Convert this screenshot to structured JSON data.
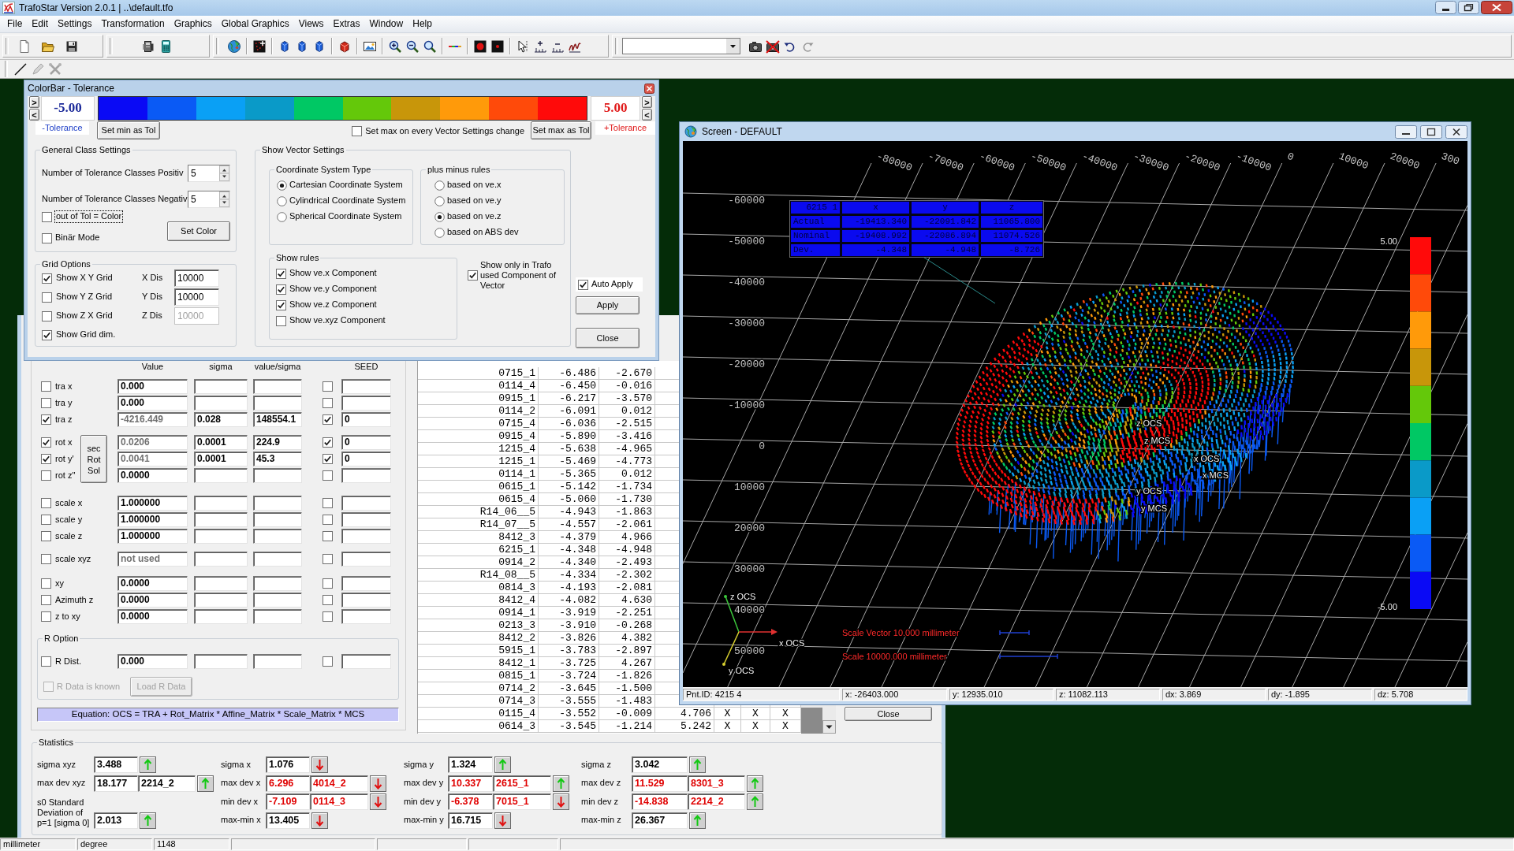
{
  "app": {
    "title": "TrafoStar Version 2.0.1 | ..\\default.tfo"
  },
  "menu": [
    "File",
    "Edit",
    "Settings",
    "Transformation",
    "Graphics",
    "Global Graphics",
    "Views",
    "Extras",
    "Window",
    "Help"
  ],
  "toolbar": [
    {
      "groups": [
        [
          {
            "kind": "new",
            "disabled": false
          },
          {
            "kind": "open",
            "disabled": false
          },
          {
            "kind": "save",
            "disabled": false
          }
        ]
      ]
    },
    {
      "groups": [
        [
          {
            "kind": "device",
            "disabled": false
          },
          {
            "kind": "calculator",
            "disabled": false
          }
        ]
      ]
    },
    {
      "groups": [
        [
          {
            "kind": "globe",
            "disabled": false
          }
        ],
        [
          {
            "kind": "points",
            "disabled": false
          }
        ],
        [
          {
            "kind": "cube",
            "disabled": false
          },
          {
            "kind": "cube",
            "disabled": false
          },
          {
            "kind": "cube",
            "disabled": false
          }
        ],
        [
          {
            "kind": "block",
            "disabled": false
          }
        ],
        [
          {
            "kind": "picture",
            "disabled": false
          }
        ],
        [
          {
            "kind": "zoomin",
            "disabled": false
          },
          {
            "kind": "zoomout",
            "disabled": false
          },
          {
            "kind": "zoom",
            "disabled": false
          }
        ],
        [
          {
            "kind": "gradient",
            "disabled": false
          }
        ],
        [
          {
            "kind": "dot",
            "disabled": false
          },
          {
            "kind": "smalldot",
            "disabled": false
          }
        ],
        [
          {
            "kind": "cursor",
            "disabled": false
          },
          {
            "kind": "axisplus",
            "disabled": false
          },
          {
            "kind": "axisminus",
            "disabled": false
          },
          {
            "kind": "scribble",
            "disabled": false
          }
        ]
      ]
    },
    {
      "groups": [
        [
          {
            "kind": "dropdown",
            "disabled": false
          },
          {
            "kind": "camera",
            "disabled": false
          },
          {
            "kind": "nocamera",
            "disabled": false
          },
          {
            "kind": "undo",
            "disabled": false
          },
          {
            "kind": "redo",
            "disabled": true
          }
        ]
      ]
    }
  ],
  "toolbar_2": [
    {
      "kind": "line",
      "disabled": false
    },
    {
      "kind": "pencil",
      "disabled": true
    },
    {
      "kind": "tools",
      "disabled": true
    }
  ],
  "colorbar_dialog": {
    "title": "ColorBar - Tolerance",
    "left_steppers": [
      ">",
      "<"
    ],
    "min_value": "-5.00",
    "classes": [
      {
        "color": "#0a0af5"
      },
      {
        "color": "#0a5af5"
      },
      {
        "color": "#0aa0f5"
      },
      {
        "color": "#0a9ac8"
      },
      {
        "color": "#00c864"
      },
      {
        "color": "#64c80a"
      },
      {
        "color": "#c8960a"
      },
      {
        "color": "#ff9a0a"
      },
      {
        "color": "#ff4a0a"
      },
      {
        "color": "#ff0a0a"
      }
    ],
    "max_value": "5.00",
    "right_steppers": [
      ">",
      "<"
    ],
    "min_label": "-Tolerance",
    "set_min_button": "Set min as Tol",
    "set_max_on_change": {
      "label": "Set max on every Vector Settings change",
      "checked": false
    },
    "set_max_button": "Set max as Tol",
    "max_label": "+Tolerance",
    "general": {
      "title": "General Class Settings",
      "positive": {
        "label": "Number of Tolerance Classes Positiv",
        "value": "5"
      },
      "negative": {
        "label": "Number of Tolerance Classes Negativ",
        "value": "5"
      },
      "out_of_tol": {
        "label": "out of Tol = Color",
        "checked": false,
        "focused": true
      },
      "binar_mode": {
        "label": "Binär Mode",
        "checked": false
      },
      "set_color_button": "Set Color"
    },
    "grid_options": {
      "title": "Grid Options",
      "items": [
        {
          "label": "Show X Y Grid",
          "checked": true,
          "distance": {
            "label": "X Dis",
            "value": "10000",
            "disabled": false
          }
        },
        {
          "label": "Show Y Z Grid",
          "checked": false,
          "distance": {
            "label": "Y Dis",
            "value": "10000",
            "disabled": false
          }
        },
        {
          "label": "Show Z X Grid",
          "checked": false,
          "distance": {
            "label": "Z Dis",
            "value": "10000",
            "disabled": true
          }
        },
        {
          "label": "Show Grid dim.",
          "checked": true
        }
      ]
    },
    "vector_settings": {
      "title": "Show Vector Settings",
      "coordinate_system": {
        "title": "Coordinate System Type",
        "options": [
          {
            "label": "Cartesian Coordinate System",
            "selected": true
          },
          {
            "label": "Cylindrical Coordinate System",
            "selected": false
          },
          {
            "label": "Spherical Coordinate System",
            "selected": false
          }
        ]
      },
      "plus_minus_rules": {
        "title": "plus minus rules",
        "options": [
          {
            "label": "based on ve.x",
            "selected": false
          },
          {
            "label": "based on ve.y",
            "selected": false
          },
          {
            "label": "based on ve.z",
            "selected": true
          },
          {
            "label": "based on ABS dev",
            "selected": false
          }
        ]
      },
      "show_rules": {
        "title": "Show rules",
        "items": [
          {
            "label": "Show ve.x Component",
            "checked": true
          },
          {
            "label": "Show ve.y Component",
            "checked": true
          },
          {
            "label": "Show ve.z Component",
            "checked": true
          },
          {
            "label": "Show ve.xyz Component",
            "checked": false
          }
        ]
      },
      "show_only_used": {
        "label": "Show only in Trafo used Component of Vector",
        "checked": true
      }
    },
    "auto_apply": {
      "label": "Auto Apply",
      "checked": true
    },
    "apply_button": "Apply",
    "close_button": "Close"
  },
  "transformation": {
    "column_headers": [
      "Value",
      "sigma",
      "value/sigma",
      "SEED"
    ],
    "groups": [
      {
        "rows": [
          {
            "label": "tra x",
            "checked": false,
            "value": "0.000",
            "value_disabled": false,
            "seed_checked": false
          },
          {
            "label": "tra y",
            "checked": false,
            "value": "0.000",
            "value_disabled": false,
            "seed_checked": false
          },
          {
            "label": "tra z",
            "checked": true,
            "value": "-4216.449",
            "value_disabled": true,
            "sigma": "0.028",
            "value_sigma": "148554.1",
            "seed_checked": true,
            "seed": "0"
          }
        ]
      },
      {
        "button": "sec Rot Sol",
        "rows": [
          {
            "label": "rot x",
            "checked": true,
            "value": "0.0206",
            "value_disabled": true,
            "sigma": "0.0001",
            "value_sigma": "224.9",
            "seed_checked": true,
            "seed": "0"
          },
          {
            "label": "rot y'",
            "checked": true,
            "value": "0.0041",
            "value_disabled": true,
            "sigma": "0.0001",
            "value_sigma": "45.3",
            "seed_checked": true,
            "seed": "0"
          },
          {
            "label": "rot z''",
            "checked": false,
            "value": "0.0000",
            "value_disabled": false,
            "seed_checked": false
          }
        ]
      },
      {
        "rows": [
          {
            "label": "scale x",
            "checked": false,
            "value": "1.000000",
            "value_disabled": false,
            "seed_checked": false
          },
          {
            "label": "scale y",
            "checked": false,
            "value": "1.000000",
            "value_disabled": false,
            "seed_checked": false
          },
          {
            "label": "scale z",
            "checked": false,
            "value": "1.000000",
            "value_disabled": false,
            "seed_checked": false
          }
        ]
      },
      {
        "rows": [
          {
            "label": "scale xyz",
            "checked": false,
            "value": "not used",
            "value_disabled": true,
            "seed_checked": false
          }
        ]
      },
      {
        "rows": [
          {
            "label": "xy",
            "checked": false,
            "value": "0.0000",
            "value_disabled": false,
            "seed_checked": false
          },
          {
            "label": "Azimuth z",
            "checked": false,
            "value": "0.0000",
            "value_disabled": false,
            "seed_checked": false
          },
          {
            "label": "z to xy",
            "checked": false,
            "value": "0.0000",
            "value_disabled": false,
            "seed_checked": false
          }
        ]
      }
    ],
    "r_option": {
      "title": "R Option",
      "r_dist": {
        "label": "R Dist.",
        "checked": false,
        "value": "0.000",
        "value_disabled": false,
        "seed_checked": false
      },
      "r_data_known": {
        "label": "R Data is known",
        "checked": false,
        "disabled": true
      },
      "load_button": {
        "label": "Load R Data",
        "disabled": true
      }
    },
    "equation": "Equation: OCS = TRA + Rot_Matrix * Affine_Matrix * Scale_Matrix * MCS"
  },
  "deviation_table": {
    "rows": [
      {
        "cells": [
          "0715_1",
          "-6.486",
          "-2.670"
        ]
      },
      {
        "cells": [
          "0114_4",
          "-6.450",
          "-0.016"
        ]
      },
      {
        "cells": [
          "0915_1",
          "-6.217",
          "-3.570"
        ]
      },
      {
        "cells": [
          "0114_2",
          "-6.091",
          "0.012"
        ]
      },
      {
        "cells": [
          "0715_4",
          "-6.036",
          "-2.515"
        ]
      },
      {
        "cells": [
          "0915_4",
          "-5.890",
          "-3.416"
        ]
      },
      {
        "cells": [
          "1215_4",
          "-5.638",
          "-4.965"
        ]
      },
      {
        "cells": [
          "1215_1",
          "-5.469",
          "-4.773"
        ]
      },
      {
        "cells": [
          "0114_1",
          "-5.365",
          "0.012"
        ]
      },
      {
        "cells": [
          "0615_1",
          "-5.142",
          "-1.734"
        ]
      },
      {
        "cells": [
          "0615_4",
          "-5.060",
          "-1.730"
        ]
      },
      {
        "cells": [
          "R14_06__5",
          "-4.943",
          "-1.863"
        ]
      },
      {
        "cells": [
          "R14_07__5",
          "-4.557",
          "-2.061"
        ]
      },
      {
        "cells": [
          "8412_3",
          "-4.379",
          "4.966"
        ]
      },
      {
        "cells": [
          "6215_1",
          "-4.348",
          "-4.948"
        ]
      },
      {
        "cells": [
          "0914_2",
          "-4.340",
          "-2.493"
        ]
      },
      {
        "cells": [
          "R14_08__5",
          "-4.334",
          "-2.302"
        ]
      },
      {
        "cells": [
          "0814_3",
          "-4.193",
          "-2.081"
        ]
      },
      {
        "cells": [
          "8412_4",
          "-4.082",
          "4.630"
        ]
      },
      {
        "cells": [
          "0914_1",
          "-3.919",
          "-2.251"
        ]
      },
      {
        "cells": [
          "0213_3",
          "-3.910",
          "-0.268"
        ]
      },
      {
        "cells": [
          "8412_2",
          "-3.826",
          "4.382"
        ]
      },
      {
        "cells": [
          "5915_1",
          "-3.783",
          "-2.897"
        ]
      },
      {
        "cells": [
          "8412_1",
          "-3.725",
          "4.267"
        ]
      },
      {
        "cells": [
          "0815_1",
          "-3.724",
          "-1.826"
        ]
      },
      {
        "cells": [
          "0714_2",
          "-3.645",
          "-1.500"
        ]
      },
      {
        "cells": [
          "0714_3",
          "-3.555",
          "-1.483"
        ]
      },
      {
        "cells": [
          "0115_4",
          "-3.552",
          "-0.009",
          "4.706",
          "X",
          "X",
          "X"
        ]
      },
      {
        "cells": [
          "0614_3",
          "-3.545",
          "-1.214",
          "5.242",
          "X",
          "X",
          "X"
        ]
      }
    ]
  },
  "form_close_button": "Close",
  "statistics": {
    "title": "Statistics",
    "columns": [
      {
        "sigma": {
          "label": "sigma xyz",
          "value": "3.488",
          "rising": true,
          "alert": false
        },
        "max_dev": {
          "label": "max dev xyz",
          "value": "18.177",
          "point": "2214_2",
          "rising": true,
          "alert": false
        },
        "s0": {
          "label": "s0 Standard Deviation of p=1 [sigma 0]",
          "value": "2.013",
          "rising": true,
          "alert": false
        }
      },
      {
        "sigma": {
          "label": "sigma x",
          "value": "1.076",
          "rising": false,
          "alert": false
        },
        "max_dev": {
          "label": "max dev x",
          "value": "6.296",
          "point": "4014_2",
          "rising": false,
          "alert": true
        },
        "min_dev": {
          "label": "min dev x",
          "value": "-7.109",
          "point": "0114_3",
          "rising": false,
          "alert": true
        },
        "max_min": {
          "label": "max-min x",
          "value": "13.405",
          "rising": false,
          "alert": false
        }
      },
      {
        "sigma": {
          "label": "sigma y",
          "value": "1.324",
          "rising": true,
          "alert": false
        },
        "max_dev": {
          "label": "max dev y",
          "value": "10.337",
          "point": "2615_1",
          "rising": true,
          "alert": true
        },
        "min_dev": {
          "label": "min dev y",
          "value": "-6.378",
          "point": "7015_1",
          "rising": false,
          "alert": true
        },
        "max_min": {
          "label": "max-min y",
          "value": "16.715",
          "rising": false,
          "alert": false
        }
      },
      {
        "sigma": {
          "label": "sigma z",
          "value": "3.042",
          "rising": true,
          "alert": false
        },
        "max_dev": {
          "label": "max dev z",
          "value": "11.529",
          "point": "8301_3",
          "rising": true,
          "alert": true
        },
        "min_dev": {
          "label": "min dev z",
          "value": "-14.838",
          "point": "2214_2",
          "rising": true,
          "alert": true
        },
        "max_min": {
          "label": "max-min z",
          "value": "26.367",
          "rising": true,
          "alert": false
        }
      }
    ]
  },
  "screen_window": {
    "title": "Screen - DEFAULT",
    "top_axis_labels": [
      "-80000",
      "-70000",
      "-60000",
      "-50000",
      "-40000",
      "-30000",
      "-20000",
      "-10000",
      "0",
      "10000",
      "20000",
      "300"
    ],
    "left_axis_labels": [
      "-60000",
      "-50000",
      "-40000",
      "-30000",
      "-20000",
      "-10000",
      "0",
      "10000",
      "20000",
      "30000",
      "40000",
      "50000"
    ],
    "info_table": {
      "columns": [
        "6215 1",
        "x",
        "y",
        "z"
      ],
      "rows": [
        [
          "Actual",
          "-19413.340",
          "-22091.842",
          "11065.800"
        ],
        [
          "Nominal",
          "-19408.992",
          "-22086.894",
          "11074.526"
        ],
        [
          "Dev.",
          "-4.348",
          "-4.948",
          "-8.726"
        ]
      ]
    },
    "cloud_labels": [
      "z OCS",
      "z MCS",
      "x OCS",
      "x MCS",
      "y OCS",
      "y MCS"
    ],
    "triad_labels": [
      "z OCS",
      "x OCS",
      "y OCS"
    ],
    "scale_bars": [
      {
        "label": "Scale Vector 10.000 millimeter"
      },
      {
        "label": "Scale 10000.000 millimeter"
      }
    ],
    "legend": {
      "max": "5.00",
      "min": "-5.00",
      "classes": [
        {
          "color": "#ff0a0a"
        },
        {
          "color": "#ff4a0a"
        },
        {
          "color": "#ff9a0a"
        },
        {
          "color": "#c8960a"
        },
        {
          "color": "#64c80a"
        },
        {
          "color": "#00c864"
        },
        {
          "color": "#0a9ac8"
        },
        {
          "color": "#0aa0f5"
        },
        {
          "color": "#0a5af5"
        },
        {
          "color": "#0a0af5"
        }
      ]
    },
    "status": [
      "Pnt.ID: 4215 4",
      "x: -26403.000",
      "y: 12935.010",
      "z: 11082.113",
      "dx: 3.869",
      "dy: -1.895",
      "dz: 5.708"
    ]
  },
  "status_bar": [
    "millimeter",
    "degree",
    "1148"
  ]
}
